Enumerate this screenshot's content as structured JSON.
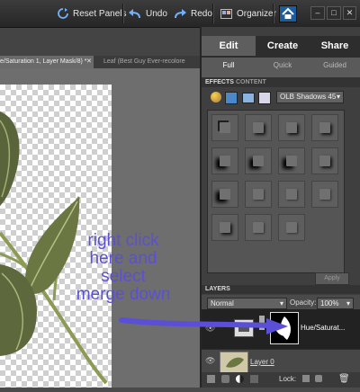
{
  "toolbar": {
    "reset_panels": "Reset Panels",
    "undo": "Undo",
    "redo": "Redo",
    "organizer": "Organizer"
  },
  "doc_tabs": [
    {
      "label": "e/Saturation 1, Layer Mask/8) *"
    },
    {
      "label": "Leaf (Best Guy Ever-recolore"
    }
  ],
  "panel": {
    "modes": [
      "Edit",
      "Create",
      "Share"
    ],
    "subtabs": [
      "Full",
      "Quick",
      "Guided"
    ],
    "effects_tabs": [
      "EFFECTS",
      "CONTENT"
    ],
    "effects_dropdown": "OLB Shadows 45",
    "apply": "Apply",
    "layers_title": "LAYERS",
    "blend_mode": "Normal",
    "opacity_label": "Opacity:",
    "opacity_value": "100%",
    "adjust_layer_name": "Hue/Saturat...",
    "layer0_name": "Layer 0",
    "lock_label": "Lock:"
  },
  "annotation": {
    "lines": [
      "right click",
      "here and",
      "select",
      "merge down"
    ]
  },
  "colors": {
    "annotation": "#5a4fd6",
    "panel": "#3f3f3f",
    "toolbar": "#2b2b2b"
  }
}
